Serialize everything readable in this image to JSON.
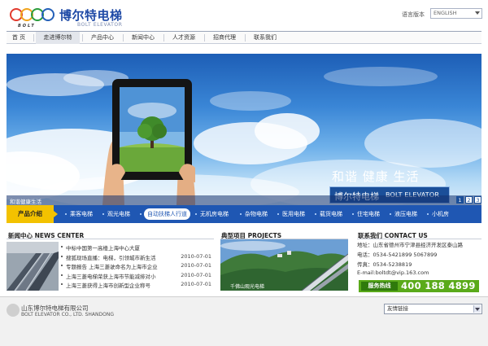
{
  "header": {
    "company_name": "博尔特电梯",
    "company_name_en": "BOLT ELEVATOR",
    "logo_text": "BOLT",
    "language_label": "语言版本",
    "language_value": "ENGLISH"
  },
  "nav": {
    "items": [
      {
        "label": "首 页"
      },
      {
        "label": "走进博尔特"
      },
      {
        "label": "产品中心"
      },
      {
        "label": "新闻中心"
      },
      {
        "label": "人才资源"
      },
      {
        "label": "招商代理"
      },
      {
        "label": "联系我们"
      }
    ],
    "active_index": 1
  },
  "banner": {
    "tagline": "和谐 健康 生活",
    "brand_cn": "博尔特电梯",
    "brand_en": "BOLT ELEVATOR",
    "caption": "和谐健康生活",
    "pages": [
      "1",
      "2",
      "3"
    ],
    "active_page": 0
  },
  "products": {
    "title": "产品介绍",
    "items": [
      {
        "label": "乘客电梯"
      },
      {
        "label": "观光电梯"
      },
      {
        "label": "自动扶梯人行道"
      },
      {
        "label": "无机房电梯"
      },
      {
        "label": "杂物电梯"
      },
      {
        "label": "医用电梯"
      },
      {
        "label": "载货电梯"
      },
      {
        "label": "住宅电梯"
      },
      {
        "label": "液压电梯"
      },
      {
        "label": "小机房"
      }
    ],
    "selected_index": 2
  },
  "news": {
    "title": "新闻中心  NEWS CENTER",
    "items": [
      {
        "title": "中标中国第一高楼上海中心大厦",
        "date": ""
      },
      {
        "title": "搜狐现场直播：电梯，引领城市新生活",
        "date": "2010-07-01"
      },
      {
        "title": "专题报告 上海三菱驶命名为上海市企业",
        "date": "2010-07-01"
      },
      {
        "title": "上海三菱电梯荣获上海市节能减排对小",
        "date": "2010-07-01"
      },
      {
        "title": "上海三菱获得上海市创新型企业称号",
        "date": "2010-07-01"
      }
    ]
  },
  "projects": {
    "title": "典型项目  PROJECTS",
    "caption": "千佛山观光电梯"
  },
  "contact": {
    "title": "联系我们  CONTACT US",
    "address": "地址：山东省德州市宁津县经济开发区泰山路",
    "phone": "电话：0534-5421899 5067899",
    "fax": "传真：0534-5238819",
    "email": "E-mail:boltdt@vip.163.com",
    "hotline_label": "服务热线",
    "hotline_number": "400 188 4899"
  },
  "footer": {
    "company_cn": "山东博尔特电梯有限公司",
    "company_en": "BOLT ELEVATOR CO., LTD. SHANDONG",
    "links_label": "友情链接"
  }
}
